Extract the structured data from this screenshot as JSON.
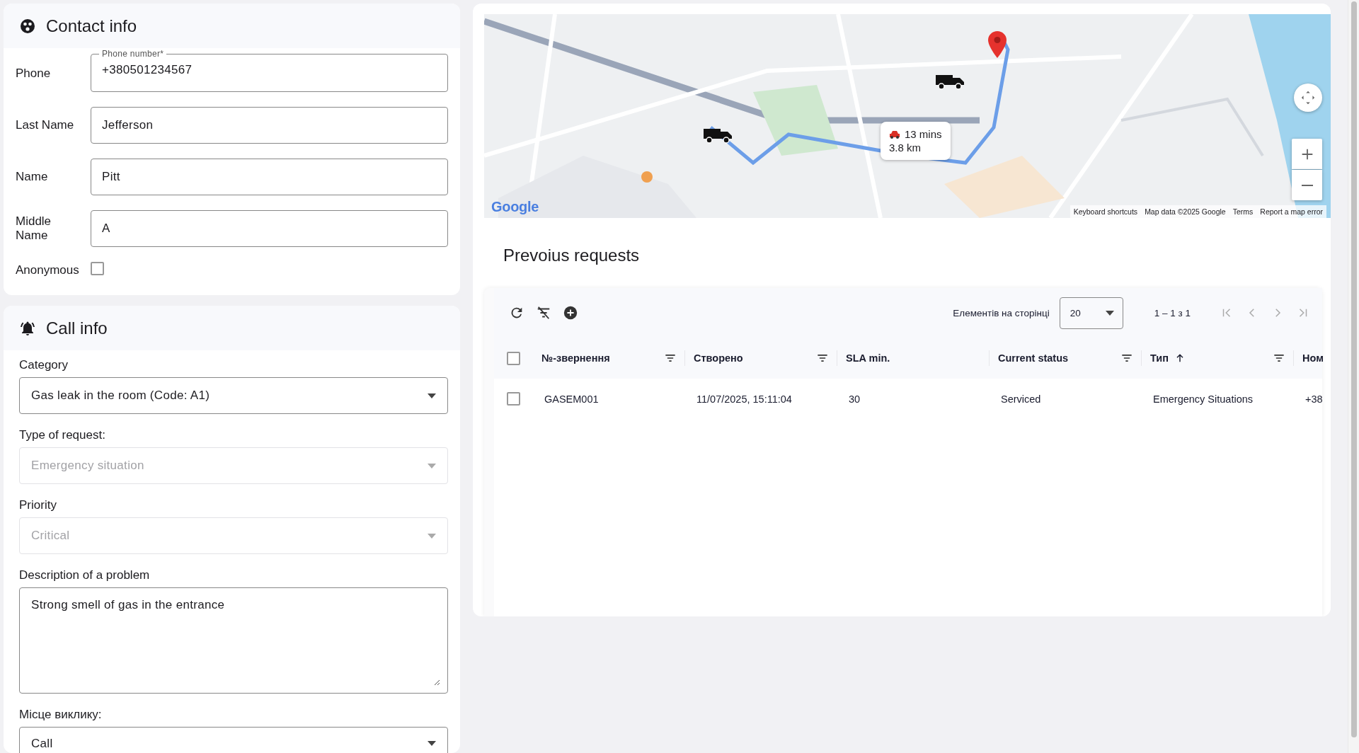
{
  "contact_info": {
    "title": "Contact info",
    "fields": [
      {
        "label": "Phone",
        "value": "+380501234567",
        "floating_label": "Phone number*"
      },
      {
        "label": "Last Name",
        "value": "Jefferson"
      },
      {
        "label": "Name",
        "value": "Pitt"
      },
      {
        "label": "Middle Name",
        "value": "A"
      }
    ],
    "anonymous": {
      "label": "Anonymous",
      "checked": false
    }
  },
  "call_info": {
    "title": "Call info",
    "fields": [
      {
        "kind": "select",
        "label": "Category",
        "value": "Gas leak in the room (Code: A1)",
        "disabled": false
      },
      {
        "kind": "select",
        "label": "Type of request:",
        "value": "Emergency situation",
        "disabled": true
      },
      {
        "kind": "select",
        "label": "Priority",
        "value": "Critical",
        "disabled": true
      },
      {
        "kind": "textarea",
        "label": "Description of a problem",
        "value": "Strong smell of gas in the entrance"
      },
      {
        "kind": "select",
        "label": "Місце виклику:",
        "value": "Call",
        "disabled": false
      }
    ]
  },
  "map": {
    "kind": "picture",
    "route_popup": {
      "duration": "13 mins",
      "distance": "3.8 km"
    },
    "logo": "Google",
    "attribution": [
      "Keyboard shortcuts",
      "Map data ©2025 Google",
      "Terms",
      "Report a map error"
    ]
  },
  "requests": {
    "title": "Prevoius requests",
    "toolbar": {
      "page_size_label": "Елементів на сторінці",
      "page_size": "20",
      "range": "1 – 1 з 1"
    },
    "header_checked": false,
    "columns": [
      {
        "label": "№-звернення",
        "filter": true,
        "sorted": false
      },
      {
        "label": "Створено",
        "filter": true,
        "sorted": false
      },
      {
        "label": "SLA min.",
        "filter": false,
        "sorted": false
      },
      {
        "label": "Current status",
        "filter": true,
        "sorted": false
      },
      {
        "label": "Тип",
        "filter": true,
        "sorted": true
      },
      {
        "label": "Ном",
        "filter": false,
        "sorted": false
      }
    ],
    "rows": [
      {
        "selected": false,
        "cells": [
          "GASEM001",
          "11/07/2025, 15:11:04",
          "30",
          "Serviced",
          "Emergency Situations",
          "+38"
        ]
      }
    ]
  }
}
